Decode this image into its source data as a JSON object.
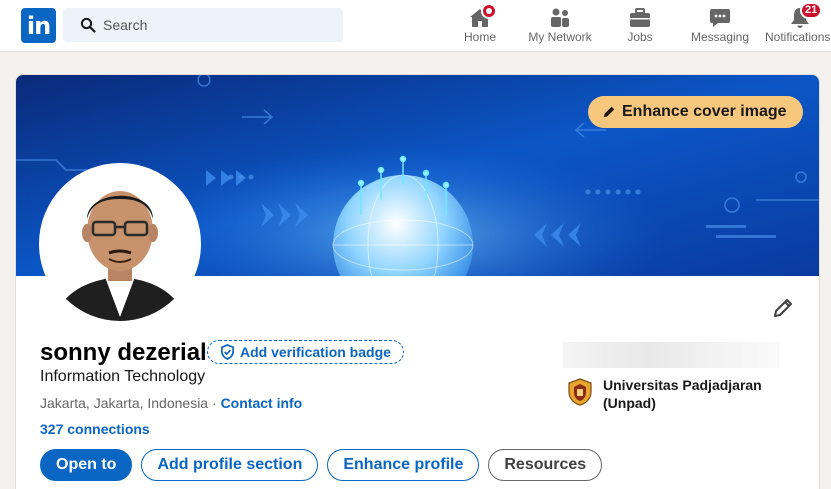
{
  "nav": {
    "logo": "in",
    "search_placeholder": "Search",
    "items": [
      {
        "label": "Home",
        "icon": "home-icon",
        "notification": true
      },
      {
        "label": "My Network",
        "icon": "network-icon"
      },
      {
        "label": "Jobs",
        "icon": "briefcase-icon"
      },
      {
        "label": "Messaging",
        "icon": "messaging-icon"
      },
      {
        "label": "Notifications",
        "icon": "bell-icon",
        "badge": "21"
      }
    ]
  },
  "profile": {
    "enhance_cover_label": "Enhance cover image",
    "name": "sonny dezerial",
    "verification_label": "Add verification badge",
    "headline": "Information Technology",
    "location": "Jakarta, Jakarta, Indonesia",
    "location_separator": " · ",
    "contact_info": "Contact info",
    "connections": "327 connections",
    "education": "Universitas Padjadjaran (Unpad)"
  },
  "actions": {
    "open_to": "Open to",
    "add_section": "Add profile section",
    "enhance_profile": "Enhance profile",
    "resources": "Resources"
  },
  "colors": {
    "brand": "#0a66c2",
    "cover_accent": "#f8c77e",
    "badge": "#cb112d"
  }
}
